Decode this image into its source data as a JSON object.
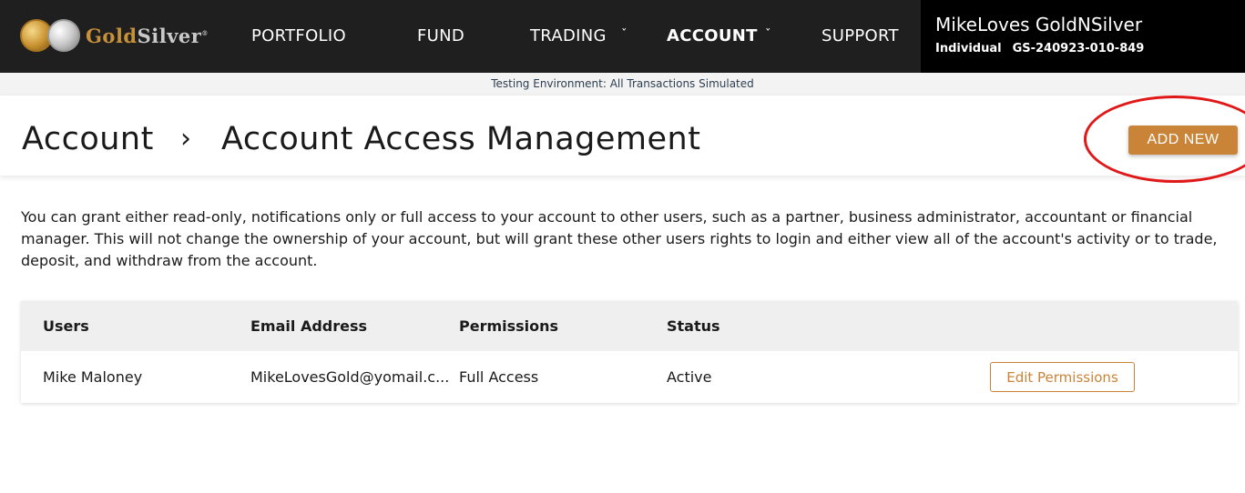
{
  "brand": {
    "name_gold": "Gold",
    "name_silver": "Silver",
    "trademark": "®",
    "gold_coin_icon": "gold-eagle-coin",
    "silver_coin_icon": "silver-eagle-coin"
  },
  "nav": {
    "items": [
      {
        "label": "PORTFOLIO"
      },
      {
        "label": "FUND"
      },
      {
        "label": "TRADING",
        "has_dropdown": true
      },
      {
        "label": "ACCOUNT",
        "has_dropdown": true,
        "active": true
      },
      {
        "label": "SUPPORT"
      }
    ],
    "chevron_glyph": "ˇ"
  },
  "account": {
    "name": "MikeLoves GoldNSilver",
    "type": "Individual",
    "id": "GS-240923-010-849"
  },
  "env_banner": "Testing Environment: All Transactions Simulated",
  "breadcrumb": {
    "parent": "Account",
    "separator": "›",
    "current": "Account Access Management"
  },
  "add_button": "ADD NEW",
  "description": "You can grant either read-only, notifications only or full access to your account to other users, such as a partner, business administrator, accountant or financial manager. This will not change the ownership of your account, but will grant these other users rights to login and either view all of the account's activity or to trade, deposit, and withdraw from the account.",
  "table": {
    "headers": [
      "Users",
      "Email Address",
      "Permissions",
      "Status"
    ],
    "rows": [
      {
        "user": "Mike Maloney",
        "email": "MikeLovesGold@yomail.c...",
        "permissions": "Full Access",
        "status": "Active",
        "action": "Edit Permissions"
      }
    ]
  },
  "colors": {
    "nav_bg": "#1f1f1f",
    "accent": "#c98438",
    "annotation": "#e01818"
  }
}
